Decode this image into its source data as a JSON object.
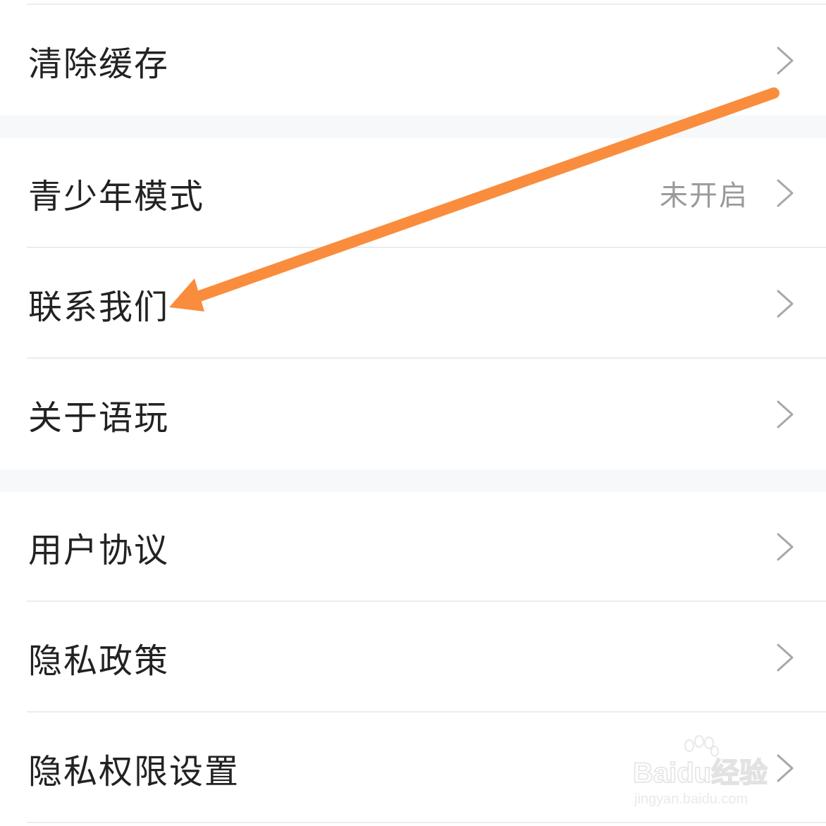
{
  "settings": {
    "rows": [
      {
        "label": "清除缓存",
        "value": ""
      },
      {
        "label": "青少年模式",
        "value": "未开启"
      },
      {
        "label": "联系我们",
        "value": ""
      },
      {
        "label": "关于语玩",
        "value": ""
      },
      {
        "label": "用户协议",
        "value": ""
      },
      {
        "label": "隐私政策",
        "value": ""
      },
      {
        "label": "隐私权限设置",
        "value": ""
      }
    ]
  },
  "icons": {
    "chevron": "chevron-right-icon",
    "annotation": "orange-arrow"
  },
  "colors": {
    "arrow": "#f98d3d",
    "text": "#222222",
    "secondary_text": "#9a9a9a",
    "divider": "#ececec",
    "group_gap": "#f7f8f9"
  },
  "watermark": {
    "brand": "Baidu经验",
    "url": "jingyan.baidu.com"
  }
}
